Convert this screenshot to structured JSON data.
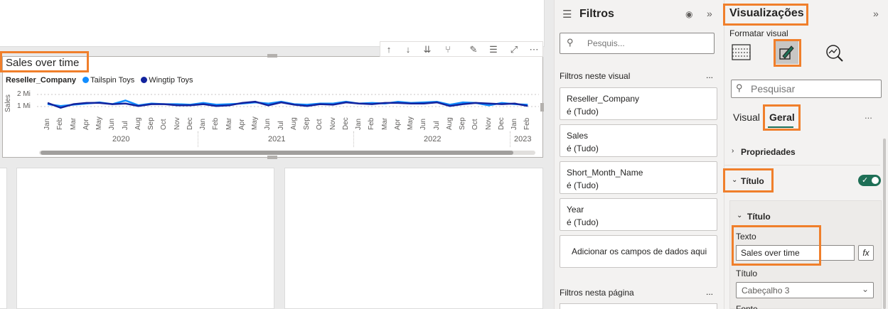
{
  "visual": {
    "title": "Sales over time",
    "legend": {
      "field": "Reseller_Company",
      "items": [
        "Tailspin Toys",
        "Wingtip Toys"
      ]
    },
    "y_axis_label": "Sales",
    "months": [
      "Jan",
      "Feb",
      "Mar",
      "Apr",
      "May",
      "Jun",
      "Jul",
      "Aug",
      "Sep",
      "Oct",
      "Nov",
      "Dec",
      "Jan",
      "Feb",
      "Mar",
      "Apr",
      "May",
      "Jun",
      "Jul",
      "Aug",
      "Sep",
      "Oct",
      "Nov",
      "Dec",
      "Jan",
      "Feb",
      "Mar",
      "Apr",
      "May",
      "Jun",
      "Jul",
      "Aug",
      "Sep",
      "Oct",
      "Nov",
      "Dec",
      "Jan",
      "Feb"
    ],
    "years": [
      "2020",
      "2021",
      "2022",
      "2023"
    ],
    "y_ticks": [
      "2 Mi",
      "1 Mi"
    ]
  },
  "chart_data": {
    "type": "line",
    "title": "Sales over time",
    "xlabel": "",
    "ylabel": "Sales",
    "ylim": [
      0,
      2000000
    ],
    "y_ticks": [
      "1 Mi",
      "2 Mi"
    ],
    "x": [
      "2020-01",
      "2020-02",
      "2020-03",
      "2020-04",
      "2020-05",
      "2020-06",
      "2020-07",
      "2020-08",
      "2020-09",
      "2020-10",
      "2020-11",
      "2020-12",
      "2021-01",
      "2021-02",
      "2021-03",
      "2021-04",
      "2021-05",
      "2021-06",
      "2021-07",
      "2021-08",
      "2021-09",
      "2021-10",
      "2021-11",
      "2021-12",
      "2022-01",
      "2022-02",
      "2022-03",
      "2022-04",
      "2022-05",
      "2022-06",
      "2022-07",
      "2022-08",
      "2022-09",
      "2022-10",
      "2022-11",
      "2022-12",
      "2023-01",
      "2023-02"
    ],
    "series": [
      {
        "name": "Tailspin Toys",
        "color": "#118dff",
        "values": [
          1200000,
          1050000,
          1150000,
          1250000,
          1350000,
          1200000,
          1500000,
          1100000,
          1250000,
          1200000,
          1200000,
          1150000,
          1300000,
          1150000,
          1200000,
          1250000,
          1350000,
          1250000,
          1400000,
          1200000,
          1150000,
          1250000,
          1250000,
          1400000,
          1250000,
          1300000,
          1250000,
          1400000,
          1300000,
          1350000,
          1400000,
          1150000,
          1350000,
          1300000,
          1100000,
          1300000,
          1200000,
          1150000
        ]
      },
      {
        "name": "Wingtip Toys",
        "color": "#12239e",
        "values": [
          1300000,
          900000,
          1200000,
          1300000,
          1300000,
          1200000,
          1250000,
          1050000,
          1200000,
          1200000,
          1100000,
          1100000,
          1200000,
          1050000,
          1100000,
          1300000,
          1400000,
          1100000,
          1350000,
          1150000,
          1050000,
          1200000,
          1150000,
          1350000,
          1250000,
          1200000,
          1300000,
          1300000,
          1250000,
          1250000,
          1350000,
          1050000,
          1200000,
          1300000,
          1250000,
          1200000,
          1250000,
          1050000
        ]
      }
    ],
    "grid": true,
    "legend_position": "top-left"
  },
  "filters": {
    "title": "Filtros",
    "search_placeholder": "Pesquis...",
    "visual_section": "Filtros neste visual",
    "more": "...",
    "items": [
      {
        "field": "Reseller_Company",
        "value": "é (Tudo)"
      },
      {
        "field": "Sales",
        "value": "é (Tudo)"
      },
      {
        "field": "Short_Month_Name",
        "value": "é (Tudo)"
      },
      {
        "field": "Year",
        "value": "é (Tudo)"
      }
    ],
    "add_fields": "Adicionar os campos de dados aqui",
    "page_section": "Filtros nesta página"
  },
  "viz": {
    "title": "Visualizações",
    "format_label": "Formatar visual",
    "search_placeholder": "Pesquisar",
    "tabs": [
      "Visual",
      "Geral"
    ],
    "more": "...",
    "properties": "Propriedades",
    "title_section": "Título",
    "title_sub": "Título",
    "text_label": "Texto",
    "text_value": "Sales over time",
    "fx": "fx",
    "heading_label": "Título",
    "heading_value": "Cabeçalho 3",
    "font_partial": "Fonte"
  }
}
